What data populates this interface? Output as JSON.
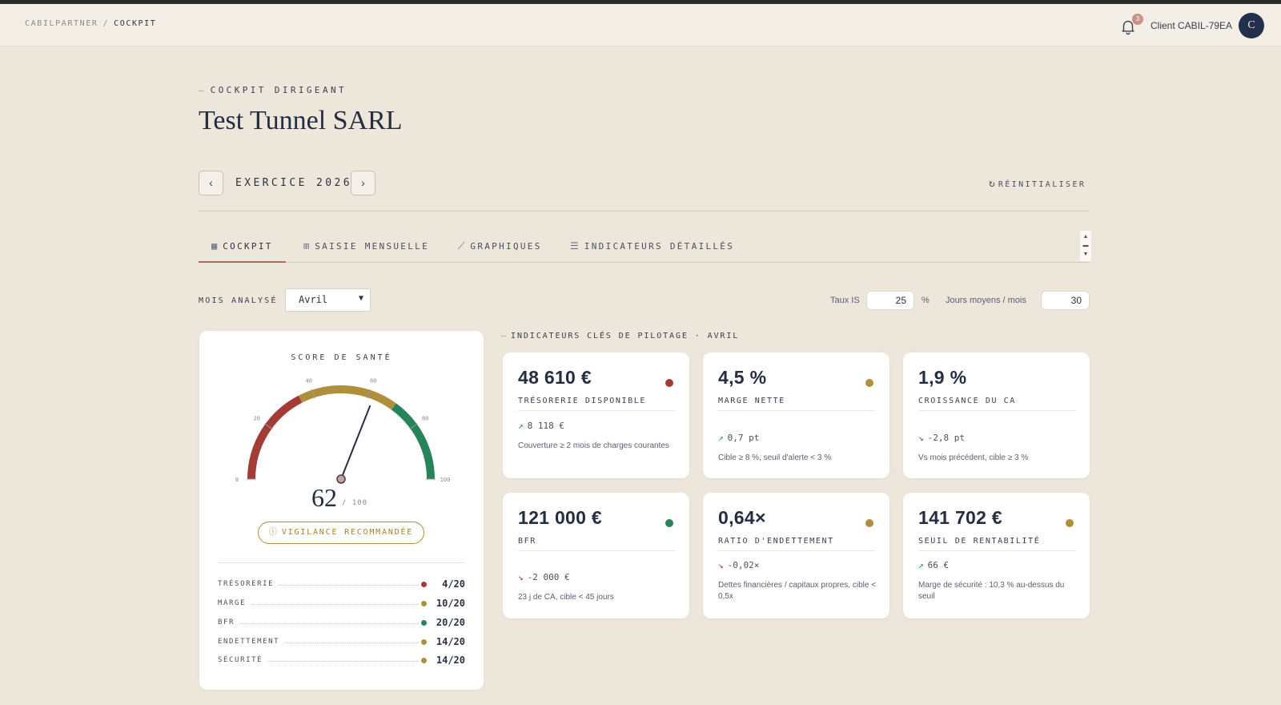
{
  "breadcrumb": {
    "root": "CABILPARTNER",
    "separator": "/",
    "current": "COCKPIT"
  },
  "header": {
    "notifications_count": "3",
    "client_name": "Client CABIL-79EA",
    "avatar_initial": "C"
  },
  "page": {
    "eyebrow": "COCKPIT DIRIGEANT",
    "eyebrow_dash": "—",
    "title": "Test Tunnel SARL"
  },
  "exercice": {
    "prev_icon": "‹",
    "label": "EXERCICE 2026",
    "next_icon": "›",
    "reset_label": "RÉINITIALISER"
  },
  "tabs": [
    {
      "label": "COCKPIT",
      "icon": "grid-icon",
      "active": true
    },
    {
      "label": "SAISIE MENSUELLE",
      "icon": "table-icon",
      "active": false
    },
    {
      "label": "GRAPHIQUES",
      "icon": "chart-icon",
      "active": false
    },
    {
      "label": "INDICATEURS DÉTAILLÉS",
      "icon": "list-icon",
      "active": false
    }
  ],
  "filters": {
    "mois_label": "MOIS ANALYSÉ",
    "mois_value": "Avril",
    "taux_is_label": "Taux IS",
    "taux_is_value": "25",
    "taux_is_unit": "%",
    "jours_label": "Jours moyens / mois",
    "jours_value": "30"
  },
  "score": {
    "title": "SCORE DE SANTÉ",
    "value": 62,
    "value_text": "62",
    "max_text": "/ 100",
    "status": "VIGILANCE RECOMMANDÉE",
    "gauge_ticks": [
      "0",
      "20",
      "40",
      "60",
      "80",
      "100"
    ],
    "gauge_colors": {
      "red": "#a33b36",
      "gold": "#b08f3c",
      "green": "#25845a"
    },
    "breakdown": [
      {
        "label": "TRÉSORERIE",
        "value": "4/20",
        "color": "#a33b36"
      },
      {
        "label": "MARGE",
        "value": "10/20",
        "color": "#b08f3c"
      },
      {
        "label": "BFR",
        "value": "20/20",
        "color": "#25845a"
      },
      {
        "label": "ENDETTEMENT",
        "value": "14/20",
        "color": "#b08f3c"
      },
      {
        "label": "SÉCURITÉ",
        "value": "14/20",
        "color": "#b08f3c"
      }
    ]
  },
  "kpi": {
    "header": "INDICATEURS CLÉS DE PILOTAGE · AVRIL",
    "cards": [
      {
        "value": "48 610 €",
        "label": "TRÉSORERIE DISPONIBLE",
        "status_color": "#a33b36",
        "trend_dir": "up",
        "trend": "8 118 €",
        "note": "Couverture ≥ 2 mois de charges courantes"
      },
      {
        "value": "4,5 %",
        "label": "MARGE NETTE",
        "status_color": "#b08f3c",
        "trend_dir": "up",
        "trend": "0,7 pt",
        "note": "Cible ≥ 8 %, seuil d'alerte < 3 %"
      },
      {
        "value": "1,9 %",
        "label": "CROISSANCE DU CA",
        "status_color": "",
        "trend_dir": "down",
        "trend": "-2,8 pt",
        "note": "Vs mois précédent, cible ≥ 3 %"
      },
      {
        "value": "121 000 €",
        "label": "BFR",
        "status_color": "#25845a",
        "trend_dir": "down",
        "trend": "-2 000 €",
        "note": "23 j de CA, cible < 45 jours"
      },
      {
        "value": "0,64×",
        "label": "RATIO D'ENDETTEMENT",
        "status_color": "#b08f3c",
        "trend_dir": "down",
        "trend": "-0,02×",
        "note": "Dettes financières / capitaux propres, cible < 0,5x"
      },
      {
        "value": "141 702 €",
        "label": "SEUIL DE RENTABILITÉ",
        "status_color": "#b08f3c",
        "trend_dir": "up",
        "trend": "66 €",
        "note": "Marge de sécurité : 10,3 % au-dessus du seuil"
      }
    ]
  }
}
